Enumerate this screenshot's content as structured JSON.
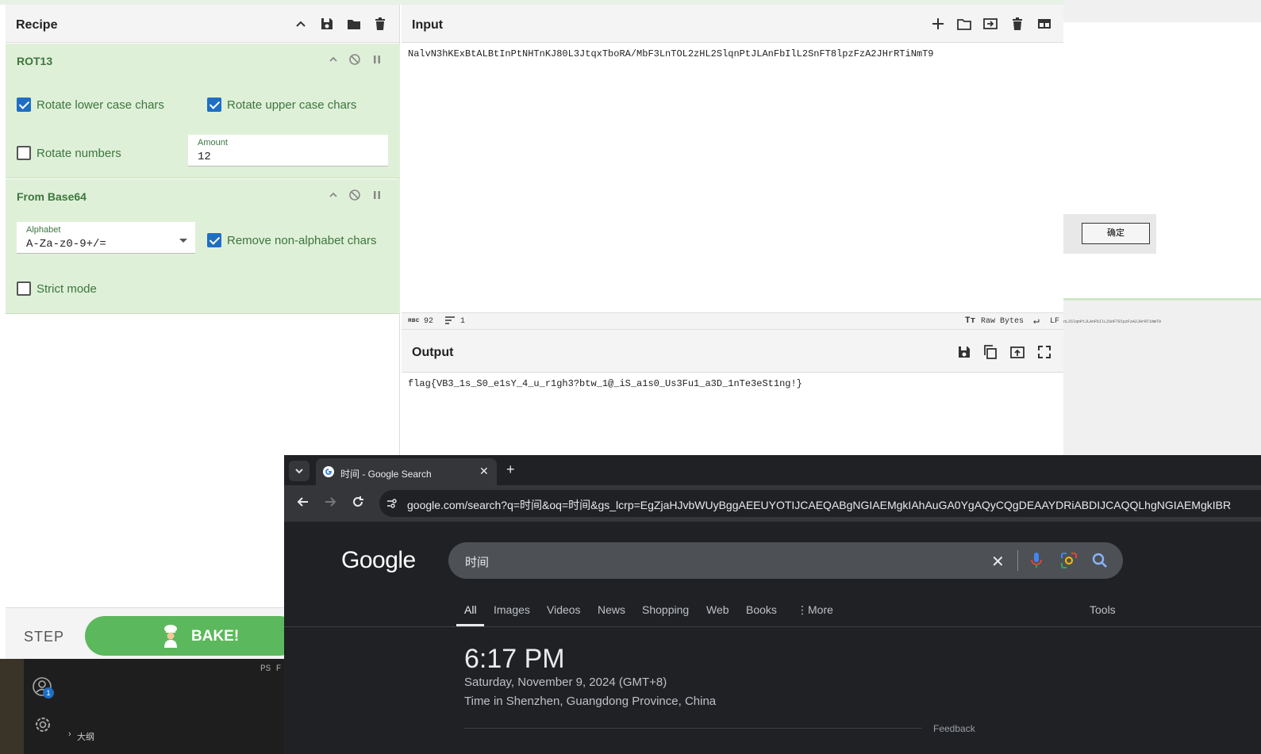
{
  "recipe": {
    "title": "Recipe",
    "operations": [
      {
        "name": "ROT13",
        "options": {
          "rotate_lower_label": "Rotate lower case chars",
          "rotate_lower_checked": true,
          "rotate_upper_label": "Rotate upper case chars",
          "rotate_upper_checked": true,
          "rotate_numbers_label": "Rotate numbers",
          "rotate_numbers_checked": false,
          "amount_label": "Amount",
          "amount_value": "12"
        }
      },
      {
        "name": "From Base64",
        "options": {
          "alphabet_label": "Alphabet",
          "alphabet_value": "A-Za-z0-9+/=",
          "remove_nonalpha_label": "Remove non-alphabet chars",
          "remove_nonalpha_checked": true,
          "strict_mode_label": "Strict mode",
          "strict_mode_checked": false
        }
      }
    ],
    "step_label": "STEP",
    "bake_label": "BAKE!"
  },
  "input": {
    "title": "Input",
    "text": "NalvN3hKExBtALBtInPtNHTnKJ80L3JtqxTboRA/MbF3LnTOL2zHL2SlqnPtJLAnFbIlL2SnFT8lpzFzA2JHrRTiNmT9",
    "status": {
      "char_icon_label": "ʀʙᴄ",
      "chars": "92",
      "lines": "1",
      "format_label": "Raw Bytes",
      "eol_label": "LF"
    }
  },
  "output": {
    "title": "Output",
    "text": "flag{VB3_1s_S0_e1sY_4_u_r1gh3?btw_1@_iS_a1s0_Us3Fu1_a3D_1nTe3eSt1ng!}"
  },
  "background_window": {
    "ok_button": "确定",
    "preview_text": "nL2SlqnPtJLAnFbIlL2SnFT8lpzFzA2JHrRTiNmT9"
  },
  "desktop": {
    "badge_count": "1",
    "editor_text": "PS F",
    "outline_label": "大纲"
  },
  "chrome": {
    "tab_title": "时间 - Google Search",
    "url_host": "google.com",
    "url_rest": "/search?q=时间&oq=时间&gs_lcrp=EgZjaHJvbWUyBggAEEUYOTIJCAEQABgNGIAEMgkIAhAuGA0YgAQyCQgDEAAYDRiABDIJCAQQLhgNGIAEMgkIBR",
    "logo": "Google",
    "search_query": "时间",
    "tabs": [
      "All",
      "Images",
      "Videos",
      "News",
      "Shopping",
      "Web",
      "Books",
      "More"
    ],
    "tools_label": "Tools",
    "time": "6:17 PM",
    "date": "Saturday, November 9, 2024 (GMT+8)",
    "location": "Time in Shenzhen, Guangdong Province, China",
    "feedback": "Feedback"
  }
}
